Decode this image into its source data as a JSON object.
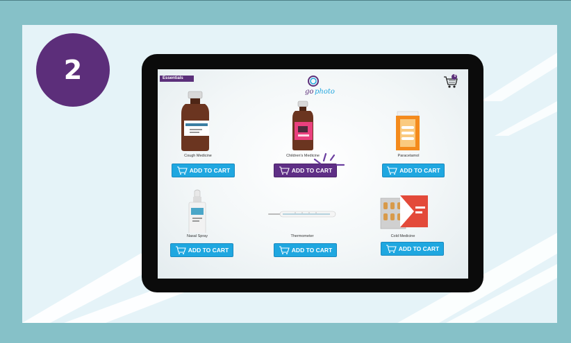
{
  "step_number": "2",
  "screen": {
    "section_label": "Essentials",
    "logo_text": "go photo",
    "cart_count": "0"
  },
  "products": [
    {
      "name": "Cough Medicine",
      "button": "ADD TO CART",
      "active": false
    },
    {
      "name": "Children's Medicine",
      "button": "ADD TO CART",
      "active": true
    },
    {
      "name": "Paracetamol",
      "button": "ADD TO CART",
      "active": false
    },
    {
      "name": "Nasal Spray",
      "button": "ADD TO CART",
      "active": false
    },
    {
      "name": "Thermometer",
      "button": "ADD TO CART",
      "active": false
    },
    {
      "name": "Cold Medicine",
      "button": "ADD TO CART",
      "active": false
    }
  ],
  "colors": {
    "background": "#86c1c8",
    "panel": "#e5f3f8",
    "brand_purple": "#5c2e7a",
    "button_blue": "#1fa7e0",
    "button_active": "#5f2f86"
  }
}
